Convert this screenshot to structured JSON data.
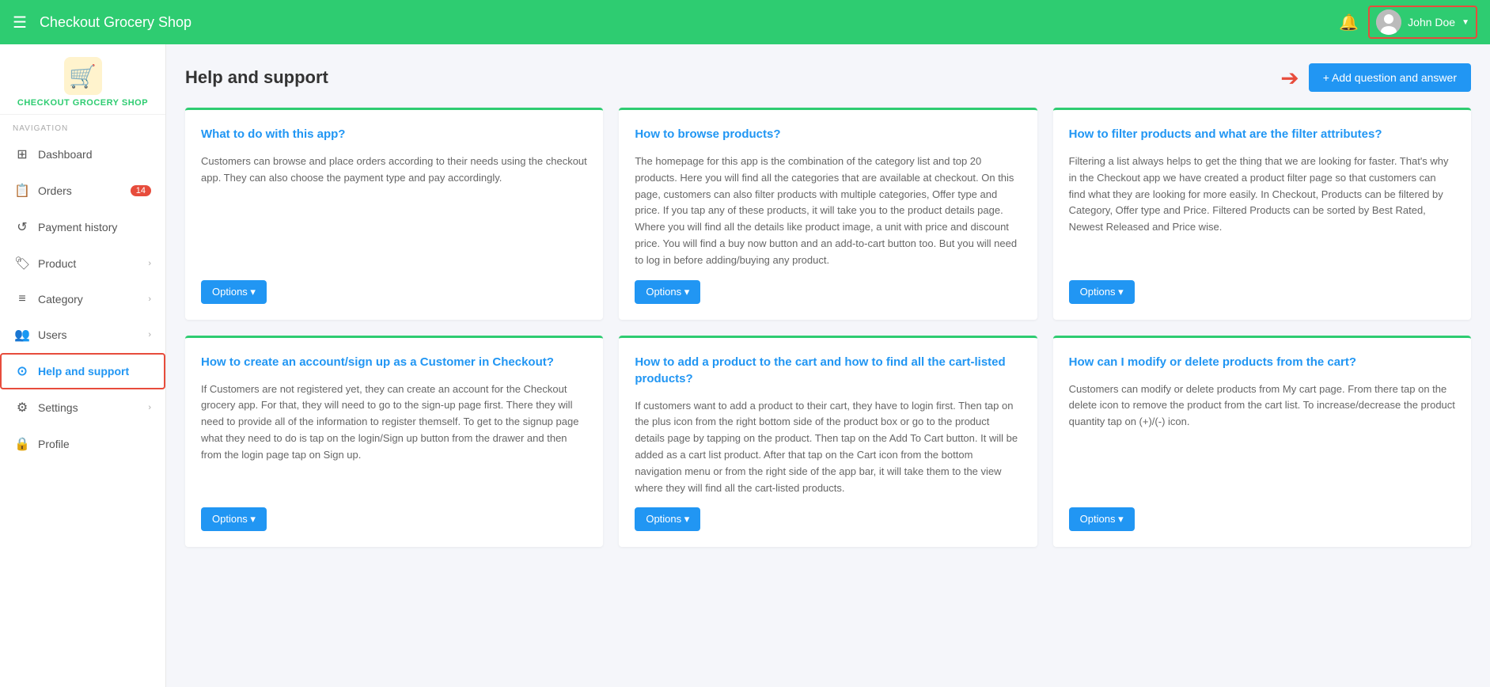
{
  "header": {
    "menu_label": "☰",
    "title": "Checkout Grocery Shop",
    "bell_icon": "🔔",
    "user": {
      "name": "John Doe",
      "dropdown_arrow": "▼"
    }
  },
  "sidebar": {
    "brand_name": "CHECKOUT GROCERY SHOP",
    "brand_emoji": "🛒",
    "nav_label": "NAVIGATION",
    "items": [
      {
        "id": "dashboard",
        "icon": "⊞",
        "label": "Dashboard",
        "badge": null,
        "chevron": false,
        "active": false
      },
      {
        "id": "orders",
        "icon": "📋",
        "label": "Orders",
        "badge": "14",
        "chevron": false,
        "active": false
      },
      {
        "id": "payment-history",
        "icon": "↺",
        "label": "Payment history",
        "badge": null,
        "chevron": false,
        "active": false
      },
      {
        "id": "product",
        "icon": "🏷",
        "label": "Product",
        "badge": null,
        "chevron": true,
        "active": false
      },
      {
        "id": "category",
        "icon": "≡",
        "label": "Category",
        "badge": null,
        "chevron": true,
        "active": false
      },
      {
        "id": "users",
        "icon": "👥",
        "label": "Users",
        "badge": null,
        "chevron": true,
        "active": false
      },
      {
        "id": "help-and-support",
        "icon": "⊙",
        "label": "Help and support",
        "badge": null,
        "chevron": false,
        "active": true
      },
      {
        "id": "settings",
        "icon": "⚙",
        "label": "Settings",
        "badge": null,
        "chevron": true,
        "active": false
      },
      {
        "id": "profile",
        "icon": "🔒",
        "label": "Profile",
        "badge": null,
        "chevron": false,
        "active": false
      }
    ]
  },
  "page": {
    "title": "Help and support",
    "add_button_label": "+ Add question and answer"
  },
  "faq_cards": [
    {
      "question": "What to do with this app?",
      "answer": "Customers can browse and place orders according to their needs using the checkout app. They can also choose the payment type and pay accordingly.",
      "options_label": "Options ▾"
    },
    {
      "question": "How to browse products?",
      "answer": "The homepage for this app is the combination of the category list and top 20 products. Here you will find all the categories that are available at checkout. On this page, customers can also filter products with multiple categories, Offer type and price. If you tap any of these products, it will take you to the product details page. Where you will find all the details like product image, a unit with price and discount price. You will find a buy now button and an add-to-cart button too. But you will need to log in before adding/buying any product.",
      "options_label": "Options ▾"
    },
    {
      "question": "How to filter products and what are the filter attributes?",
      "answer": "Filtering a list always helps to get the thing that we are looking for faster. That's why in the Checkout app we have created a product filter page so that customers can find what they are looking for more easily. In Checkout, Products can be filtered by Category, Offer type and Price. Filtered Products can be sorted by Best Rated, Newest Released and Price wise.",
      "options_label": "Options ▾"
    },
    {
      "question": "How to create an account/sign up as a Customer in Checkout?",
      "answer": "If Customers are not registered yet, they can create an account for the Checkout grocery app. For that, they will need to go to the sign-up page first. There they will need to provide all of the information to register themself. To get to the signup page what they need to do is tap on the login/Sign up button from the drawer and then from the login page tap on Sign up.",
      "options_label": "Options ▾"
    },
    {
      "question": "How to add a product to the cart and how to find all the cart-listed products?",
      "answer": "If customers want to add a product to their cart, they have to login first. Then tap on the plus icon from the right bottom side of the product box or go to the product details page by tapping on the product. Then tap on the Add To Cart button. It will be added as a cart list product. After that tap on the Cart icon from the bottom navigation menu or from the right side of the app bar, it will take them to the view where they will find all the cart-listed products.",
      "options_label": "Options ▾"
    },
    {
      "question": "How can I modify or delete products from the cart?",
      "answer": "Customers can modify or delete products from My cart page. From there tap on the delete icon to remove the product from the cart list. To increase/decrease the product quantity tap on (+)/(-) icon.",
      "options_label": "Options ▾"
    }
  ]
}
